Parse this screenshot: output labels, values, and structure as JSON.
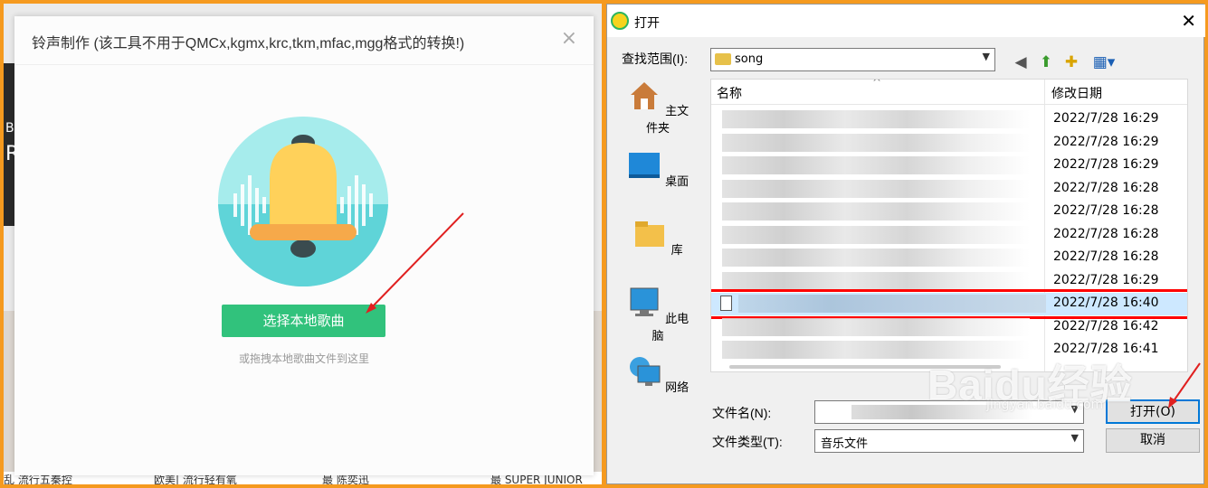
{
  "left_app": {
    "bottom_items": [
      "乱 流行五秦控",
      "欧美| 流行轻有氧",
      "最 陈奕迅",
      "最 SUPER JUNIOR"
    ],
    "dialog": {
      "title": "铃声制作 (该工具不用于QMCx,kgmx,krc,tkm,mfac,mgg格式的转换!)",
      "close": "×",
      "pick_button": "选择本地歌曲",
      "drag_hint": "或拖拽本地歌曲文件到这里"
    }
  },
  "open_dialog": {
    "title": "打开",
    "close": "✕",
    "look_in_label": "查找范围(I):",
    "look_in_value": "song",
    "places": [
      "主文件夹",
      "桌面",
      "库",
      "此电脑",
      "网络"
    ],
    "columns": [
      "名称",
      "修改日期"
    ],
    "rows": [
      {
        "date": "2022/7/28 16:29",
        "selected": false
      },
      {
        "date": "2022/7/28 16:29",
        "selected": false
      },
      {
        "date": "2022/7/28 16:29",
        "selected": false
      },
      {
        "date": "2022/7/28 16:28",
        "selected": false
      },
      {
        "date": "2022/7/28 16:28",
        "selected": false
      },
      {
        "date": "2022/7/28 16:28",
        "selected": false
      },
      {
        "date": "2022/7/28 16:28",
        "selected": false
      },
      {
        "date": "2022/7/28 16:29",
        "selected": false
      },
      {
        "date": "2022/7/28 16:40",
        "selected": true
      },
      {
        "date": "2022/7/28 16:42",
        "selected": false
      },
      {
        "date": "2022/7/28 16:41",
        "selected": false
      }
    ],
    "filename_label": "文件名(N):",
    "filetype_label": "文件类型(T):",
    "filetype_value": "音乐文件",
    "open_button": "打开(O)",
    "cancel_button": "取消"
  },
  "watermark": {
    "main": "Baidu经验",
    "sub": "jingyan.baidu.com"
  },
  "colors": {
    "accent_green": "#31c27c",
    "frame_orange": "#f59a1f",
    "highlight_red": "#ff0000",
    "selection_blue": "#cde8ff"
  }
}
